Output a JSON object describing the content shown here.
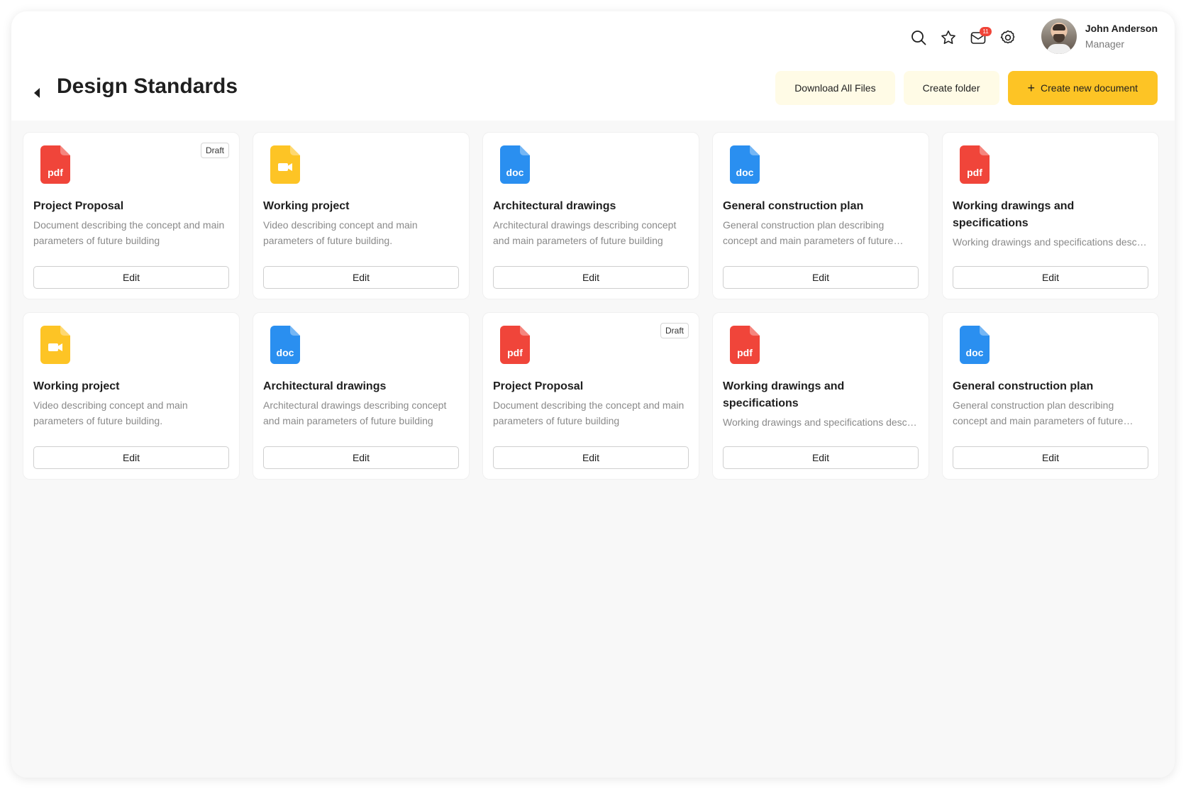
{
  "header": {
    "title": "Design Standards",
    "notification_count": "11",
    "user": {
      "name": "John Anderson",
      "role": "Manager"
    },
    "actions": {
      "download_label": "Download All Files",
      "create_folder_label": "Create folder",
      "create_document_label": "Create new document"
    }
  },
  "colors": {
    "pdf": "#f0453a",
    "doc": "#2a8ff0",
    "video": "#fdc425",
    "accent": "#fdc425",
    "soft_button": "#fffbe6"
  },
  "cards": [
    {
      "type": "pdf",
      "icon": "pdf-file-icon",
      "ext": "pdf",
      "badge": "Draft",
      "title": "Project Proposal",
      "description": "Document describing the concept and main parameters of future building",
      "edit_label": "Edit"
    },
    {
      "type": "video",
      "icon": "video-file-icon",
      "ext": "",
      "badge": "",
      "title": "Working project",
      "description": "Video describing concept and main parameters of future building.",
      "edit_label": "Edit"
    },
    {
      "type": "doc",
      "icon": "doc-file-icon",
      "ext": "doc",
      "badge": "",
      "title": "Architectural drawings",
      "description": "Architectural drawings describing concept and main parameters of future building",
      "edit_label": "Edit"
    },
    {
      "type": "doc",
      "icon": "doc-file-icon",
      "ext": "doc",
      "badge": "",
      "title": "General construction plan",
      "description": "General construction plan describing concept and main parameters of future building",
      "edit_label": "Edit"
    },
    {
      "type": "pdf",
      "icon": "pdf-file-icon",
      "ext": "pdf",
      "badge": "",
      "title": "Working drawings and specifications",
      "description": "Working drawings and specifications describing concept",
      "edit_label": "Edit"
    },
    {
      "type": "video",
      "icon": "video-file-icon",
      "ext": "",
      "badge": "",
      "title": "Working project",
      "description": "Video describing concept and main parameters of future building.",
      "edit_label": "Edit"
    },
    {
      "type": "doc",
      "icon": "doc-file-icon",
      "ext": "doc",
      "badge": "",
      "title": "Architectural drawings",
      "description": "Architectural drawings describing concept and main parameters of future building",
      "edit_label": "Edit"
    },
    {
      "type": "pdf",
      "icon": "pdf-file-icon",
      "ext": "pdf",
      "badge": "Draft",
      "title": "Project Proposal",
      "description": "Document describing the concept and main parameters of future building",
      "edit_label": "Edit"
    },
    {
      "type": "pdf",
      "icon": "pdf-file-icon",
      "ext": "pdf",
      "badge": "",
      "title": "Working drawings and specifications",
      "description": "Working drawings and specifications describing concept",
      "edit_label": "Edit"
    },
    {
      "type": "doc",
      "icon": "doc-file-icon",
      "ext": "doc",
      "badge": "",
      "title": "General construction plan",
      "description": "General construction plan describing concept and main parameters of future building",
      "edit_label": "Edit"
    }
  ]
}
